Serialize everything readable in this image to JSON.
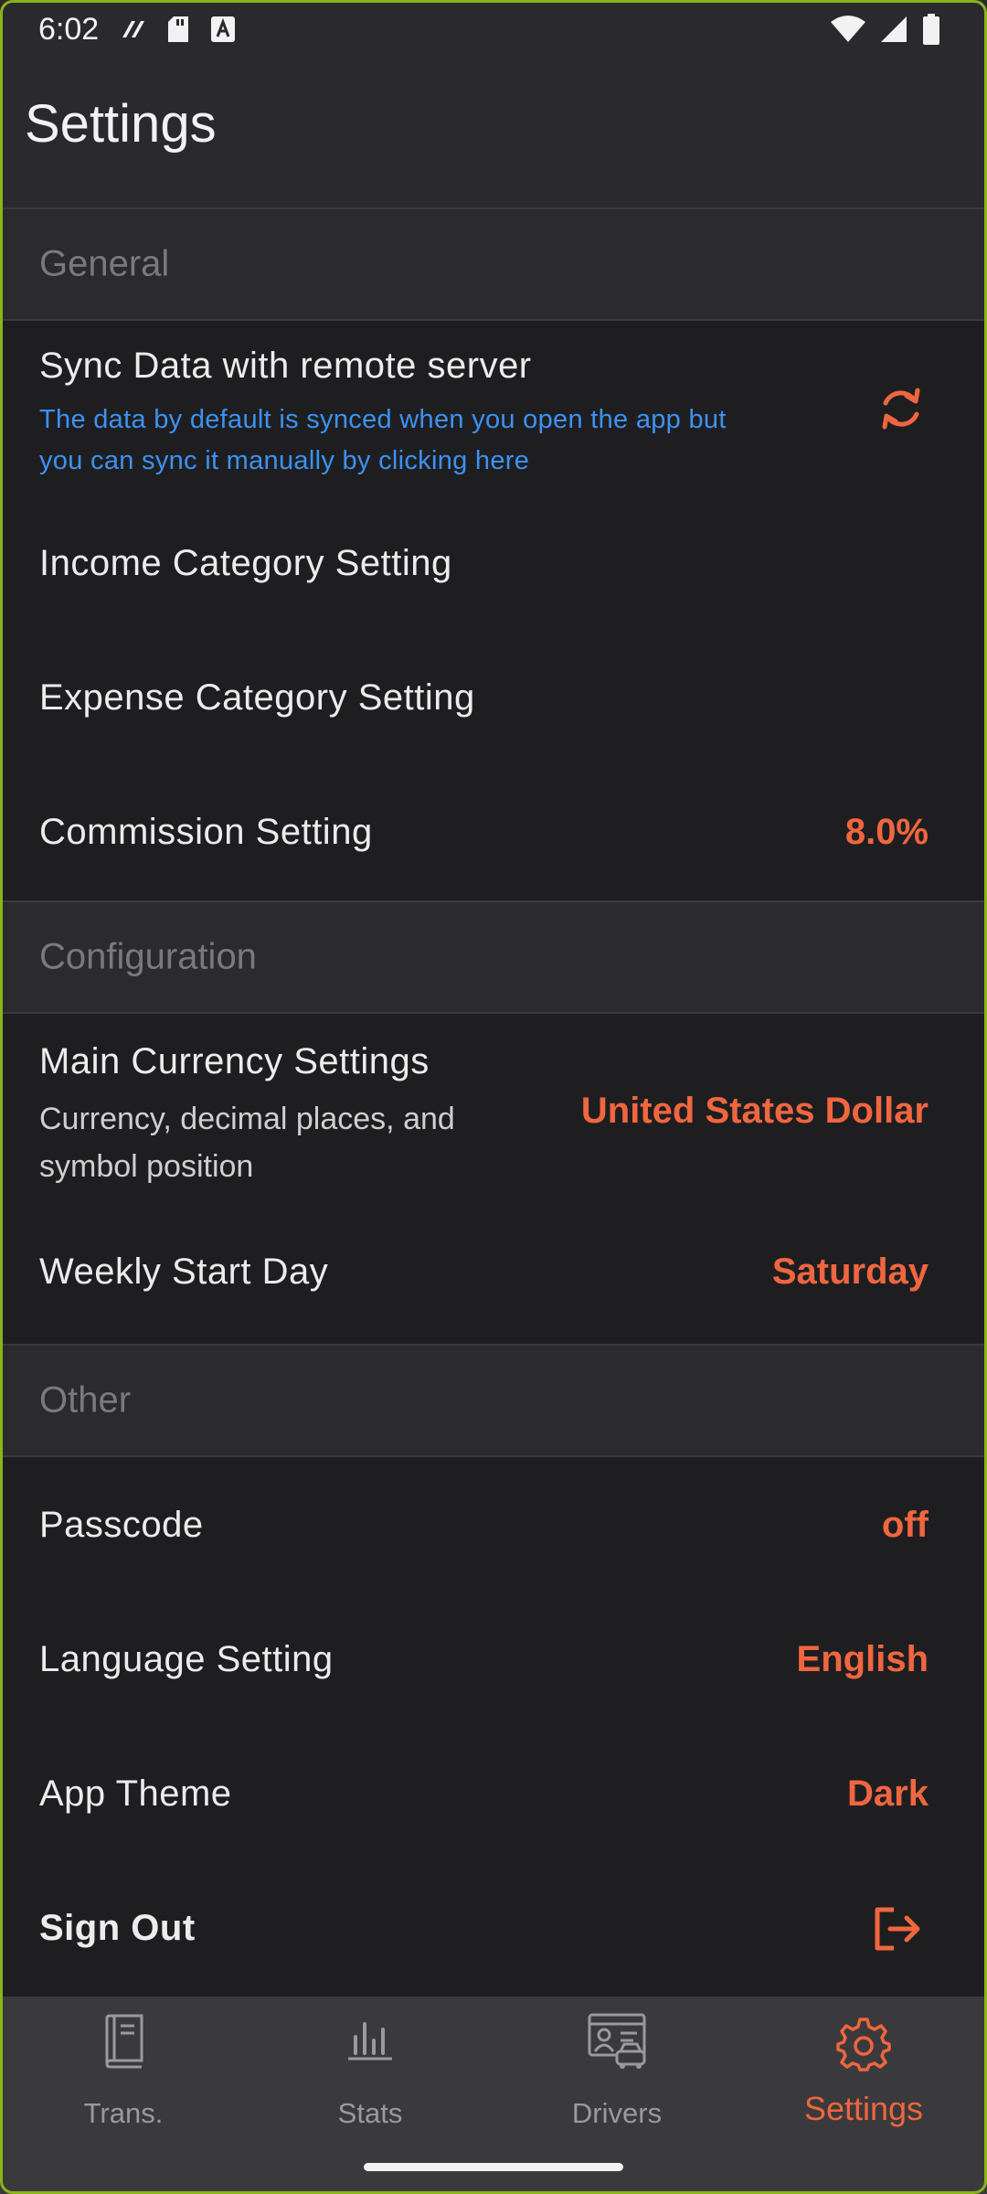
{
  "status_bar": {
    "time": "6:02"
  },
  "app_bar": {
    "title": "Settings"
  },
  "sections": {
    "general": "General",
    "configuration": "Configuration",
    "other": "Other"
  },
  "general": {
    "sync": {
      "title": "Sync Data with remote server",
      "description_line1": "The data by default is synced when you open the app but",
      "description_line2": "you can sync it manually by clicking here"
    },
    "income_category": "Income Category Setting",
    "expense_category": "Expense Category Setting",
    "commission": {
      "label": "Commission Setting",
      "value": "8.0%"
    }
  },
  "configuration": {
    "currency": {
      "label": "Main Currency Settings",
      "sub_line1": "Currency, decimal places, and",
      "sub_line2": "symbol position",
      "value": "United States Dollar"
    },
    "weekly_start": {
      "label": "Weekly Start Day",
      "value": "Saturday"
    }
  },
  "other": {
    "passcode": {
      "label": "Passcode",
      "value": "off"
    },
    "language": {
      "label": "Language Setting",
      "value": "English"
    },
    "theme": {
      "label": "App Theme",
      "value": "Dark"
    },
    "sign_out": {
      "label": "Sign Out"
    }
  },
  "bottom_nav": {
    "items": [
      {
        "label": "Trans.",
        "icon": "book-icon"
      },
      {
        "label": "Stats",
        "icon": "bar-chart-icon"
      },
      {
        "label": "Drivers",
        "icon": "driver-card-icon"
      },
      {
        "label": "Settings",
        "icon": "gear-icon"
      }
    ],
    "active": "Settings"
  },
  "colors": {
    "accent": "#f0663f",
    "link": "#3c92f0",
    "background": "#1e1e21",
    "section_header": "#2b2b2e",
    "nav_background": "#3a3a3d"
  }
}
